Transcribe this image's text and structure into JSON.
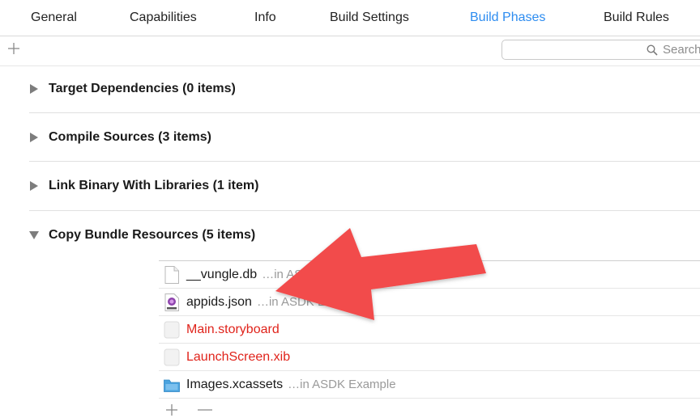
{
  "tabs": [
    {
      "label": "General"
    },
    {
      "label": "Capabilities"
    },
    {
      "label": "Info"
    },
    {
      "label": "Build Settings"
    },
    {
      "label": "Build Phases",
      "active": true
    },
    {
      "label": "Build Rules"
    }
  ],
  "toolbar": {
    "search_placeholder": "Search"
  },
  "phases": [
    {
      "title": "Target Dependencies (0 items)",
      "expanded": false
    },
    {
      "title": "Compile Sources (3 items)",
      "expanded": false
    },
    {
      "title": "Link Binary With Libraries (1 item)",
      "expanded": false
    },
    {
      "title": "Copy Bundle Resources (5 items)",
      "expanded": true
    }
  ],
  "resources": [
    {
      "name": "__vungle.db",
      "location": "…in ASDK Example",
      "icon": "document-icon",
      "missing": false
    },
    {
      "name": "appids.json",
      "location": "…in ASDK Example",
      "icon": "json-file-icon",
      "missing": false
    },
    {
      "name": "Main.storyboard",
      "location": "",
      "icon": "placeholder-file-icon",
      "missing": true
    },
    {
      "name": "LaunchScreen.xib",
      "location": "",
      "icon": "placeholder-file-icon",
      "missing": true
    },
    {
      "name": "Images.xcassets",
      "location": "…in ASDK Example",
      "icon": "folder-icon",
      "missing": false
    }
  ],
  "colors": {
    "active_tab": "#2d8cf0",
    "missing_file": "#e0231b",
    "annotation_arrow": "#f24b4b"
  }
}
